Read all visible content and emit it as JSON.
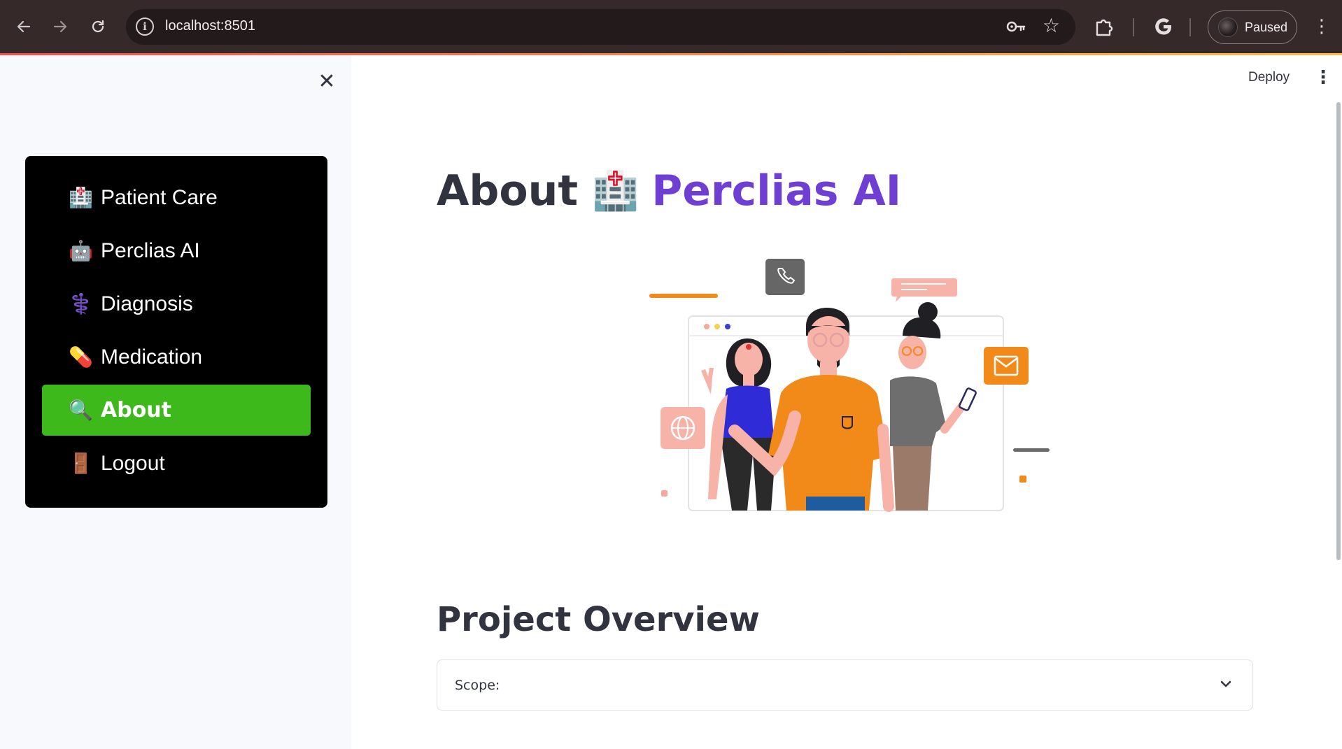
{
  "browser": {
    "url": "localhost:8501",
    "profile_status": "Paused"
  },
  "sidebar": {
    "items": [
      {
        "emoji": "🏥",
        "label": "Patient Care",
        "active": false
      },
      {
        "emoji": "🤖",
        "label": "Perclias AI",
        "active": false
      },
      {
        "emoji": "⚕️",
        "label": "Diagnosis",
        "active": false
      },
      {
        "emoji": "💊",
        "label": "Medication",
        "active": false
      },
      {
        "emoji": "🔍",
        "label": "About",
        "active": true
      },
      {
        "emoji": "🚪",
        "label": "Logout",
        "active": false
      }
    ],
    "active_color": "#3db91c"
  },
  "header": {
    "deploy_label": "Deploy"
  },
  "main": {
    "title_prefix": "About",
    "title_emoji": "🏥",
    "title_brand": "Perclias AI",
    "brand_color": "#6f3fd4",
    "section_title": "Project Overview",
    "expander_label": "Scope:"
  }
}
